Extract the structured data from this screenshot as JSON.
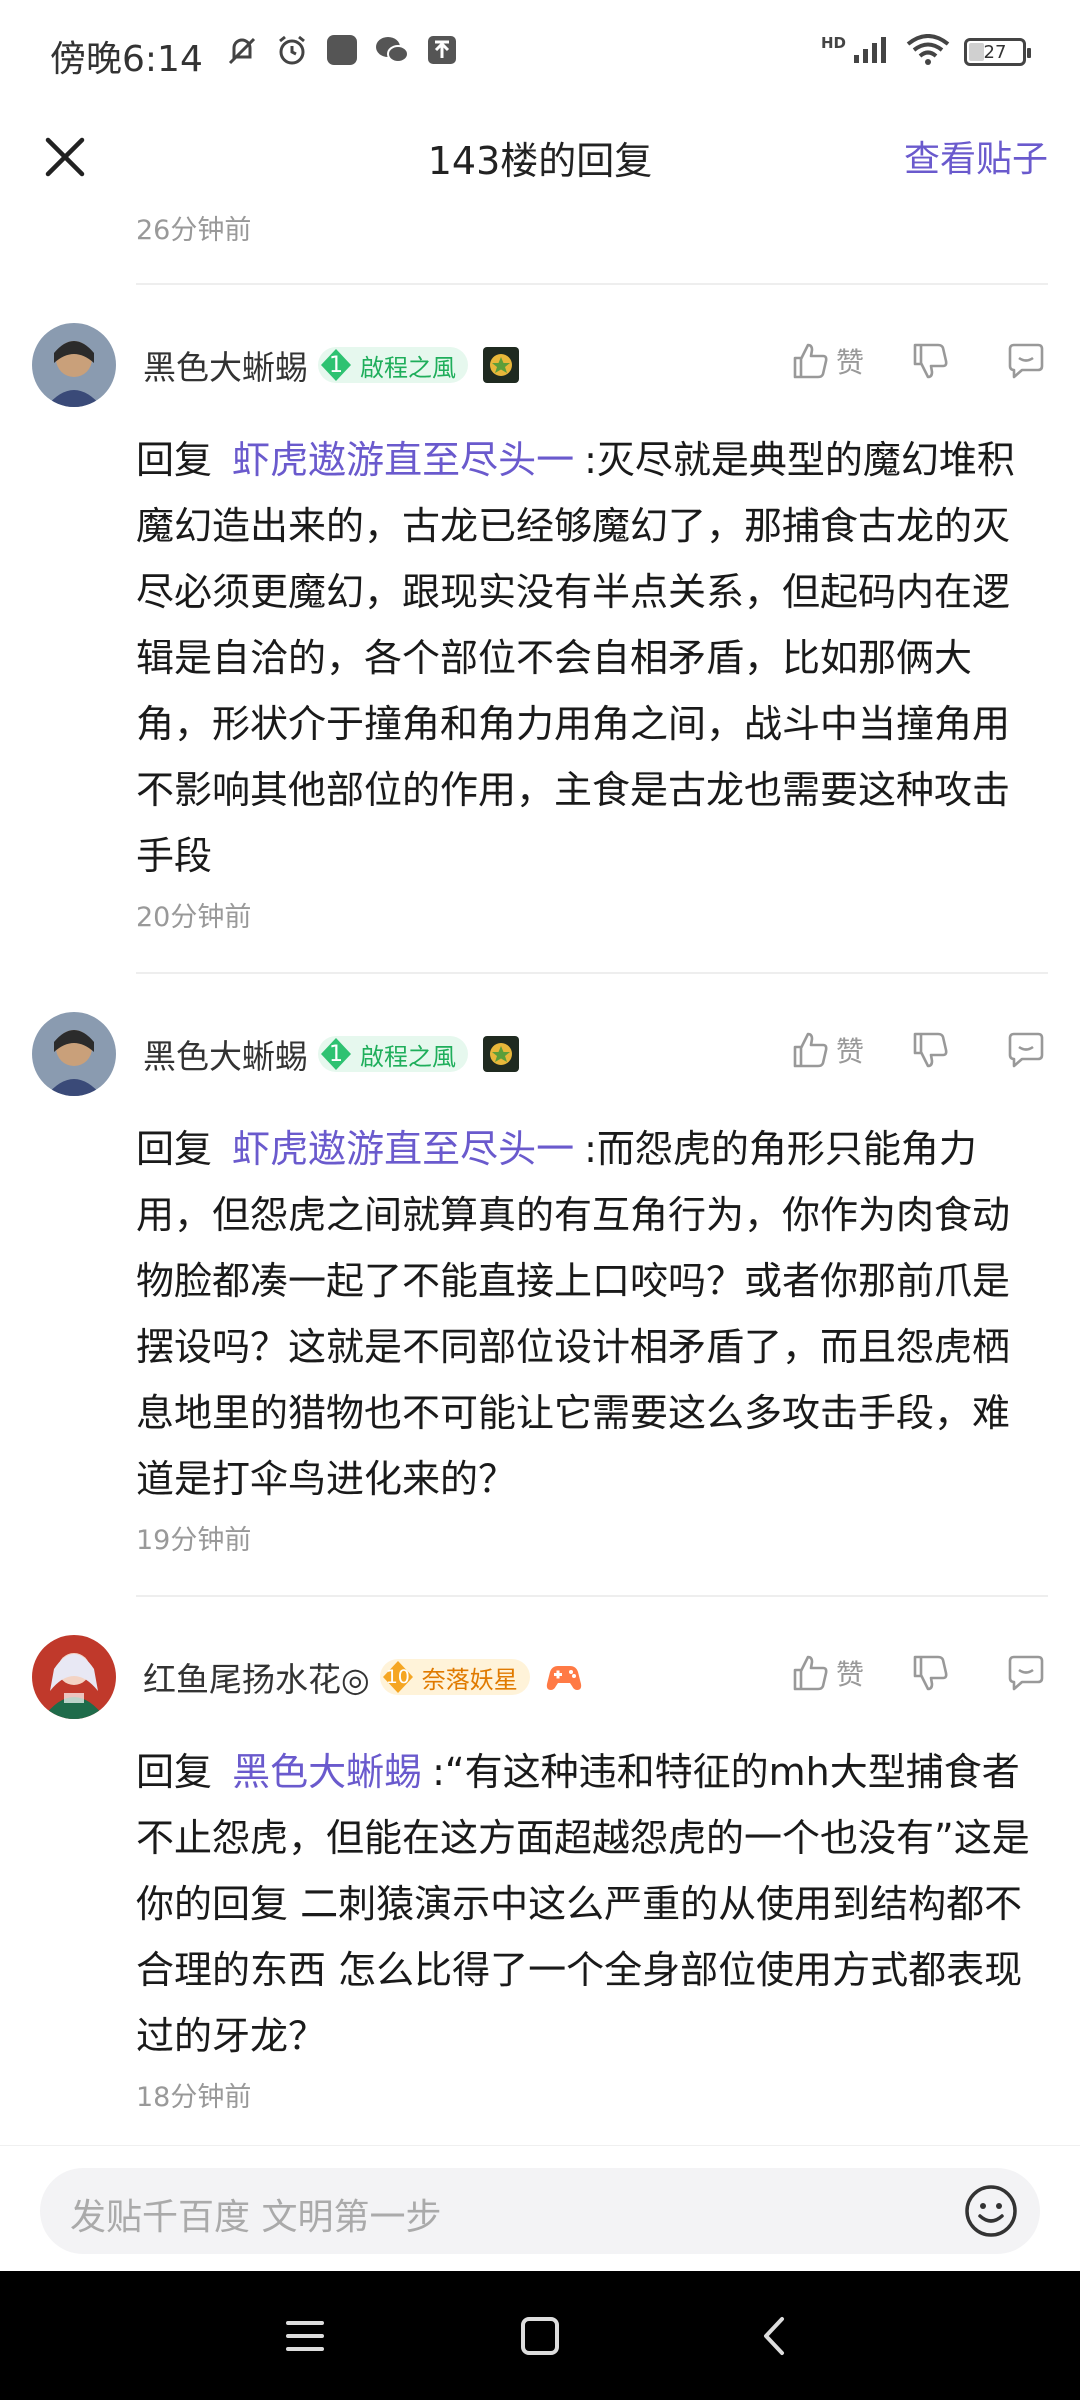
{
  "status_bar": {
    "time": "傍晚6:14",
    "network": "HD",
    "battery": "27",
    "battery_level": 0.27,
    "icons": [
      "notification-muted-icon",
      "alarm-icon",
      "app-icon",
      "wechat-icon",
      "upload-icon",
      "signal-icon",
      "wifi-icon",
      "battery-icon"
    ]
  },
  "header": {
    "title": "143楼的回复",
    "view_post": "查看贴子"
  },
  "top_time": "26分钟前",
  "comments": [
    {
      "username": "黑色大蜥蜴",
      "level": "1",
      "level_name": "啟程之風",
      "reply_prefix": "回复",
      "mention": "虾虎遨游直至尽头一",
      "text": ":灭尽就是典型的魔幻堆积魔幻造出来的，古龙已经够魔幻了，那捕食古龙的灭尽必须更魔幻，跟现实没有半点关系，但起码内在逻辑是自洽的，各个部位不会自相矛盾，比如那俩大角，形状介于撞角和角力用角之间，战斗中当撞角用不影响其他部位的作用，主食是古龙也需要这种攻击手段",
      "like_label": "赞",
      "time": "20分钟前"
    },
    {
      "username": "黑色大蜥蜴",
      "level": "1",
      "level_name": "啟程之風",
      "reply_prefix": "回复",
      "mention": "虾虎遨游直至尽头一",
      "text": ":而怨虎的角形只能角力用，但怨虎之间就算真的有互角行为，你作为肉食动物脸都凑一起了不能直接上口咬吗？或者你那前爪是摆设吗？这就是不同部位设计相矛盾了，而且怨虎栖息地里的猎物也不可能让它需要这么多攻击手段，难道是打伞鸟进化来的？",
      "like_label": "赞",
      "time": "19分钟前"
    },
    {
      "username": "红鱼尾扬水花◎",
      "level": "10",
      "level_name": "奈落妖星",
      "reply_prefix": "回复",
      "mention": "黑色大蜥蜴",
      "text": ":“有这种违和特征的mh大型捕食者不止怨虎，但能在这方面超越怨虎的一个也没有”这是你的回复 二刺猿演示中这么严重的从使用到结构都不合理的东西 怎么比得了一个全身部位使用方式都表现过的牙龙？",
      "like_label": "赞",
      "time": "18分钟前"
    }
  ],
  "input": {
    "placeholder": "发贴千百度 文明第一步"
  },
  "colors": {
    "accent": "#6a5acd",
    "level_green": "#1fae5b",
    "level_gold": "#e07a00"
  }
}
